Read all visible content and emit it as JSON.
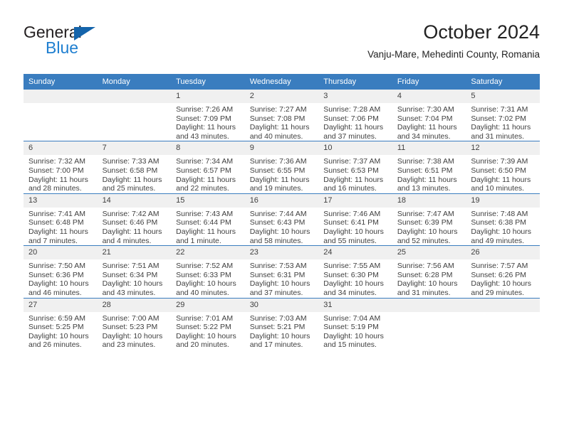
{
  "brand": {
    "name_top": "General",
    "name_bottom": "Blue",
    "triangle_color": "#1464ab",
    "top_color": "#231f20",
    "bottom_color": "#1f7fd0"
  },
  "header": {
    "title": "October 2024",
    "subtitle": "Vanju-Mare, Mehedinti County, Romania"
  },
  "theme": {
    "header_row_bg": "#3a7dbf",
    "header_row_text": "#ffffff",
    "daynum_bg": "#f0f0f0",
    "row_divider": "#3a7dbf",
    "body_text": "#3f3f3f"
  },
  "calendar": {
    "weekday_headers": [
      "Sunday",
      "Monday",
      "Tuesday",
      "Wednesday",
      "Thursday",
      "Friday",
      "Saturday"
    ],
    "labels": {
      "sunrise_prefix": "Sunrise:",
      "sunset_prefix": "Sunset:",
      "daylight_prefix": "Daylight:"
    },
    "weeks": [
      [
        {
          "day": "",
          "sunrise": "",
          "sunset": "",
          "daylight": "",
          "blank": true
        },
        {
          "day": "",
          "sunrise": "",
          "sunset": "",
          "daylight": "",
          "blank": true
        },
        {
          "day": "1",
          "sunrise": "Sunrise: 7:26 AM",
          "sunset": "Sunset: 7:09 PM",
          "daylight": "Daylight: 11 hours and 43 minutes."
        },
        {
          "day": "2",
          "sunrise": "Sunrise: 7:27 AM",
          "sunset": "Sunset: 7:08 PM",
          "daylight": "Daylight: 11 hours and 40 minutes."
        },
        {
          "day": "3",
          "sunrise": "Sunrise: 7:28 AM",
          "sunset": "Sunset: 7:06 PM",
          "daylight": "Daylight: 11 hours and 37 minutes."
        },
        {
          "day": "4",
          "sunrise": "Sunrise: 7:30 AM",
          "sunset": "Sunset: 7:04 PM",
          "daylight": "Daylight: 11 hours and 34 minutes."
        },
        {
          "day": "5",
          "sunrise": "Sunrise: 7:31 AM",
          "sunset": "Sunset: 7:02 PM",
          "daylight": "Daylight: 11 hours and 31 minutes."
        }
      ],
      [
        {
          "day": "6",
          "sunrise": "Sunrise: 7:32 AM",
          "sunset": "Sunset: 7:00 PM",
          "daylight": "Daylight: 11 hours and 28 minutes."
        },
        {
          "day": "7",
          "sunrise": "Sunrise: 7:33 AM",
          "sunset": "Sunset: 6:58 PM",
          "daylight": "Daylight: 11 hours and 25 minutes."
        },
        {
          "day": "8",
          "sunrise": "Sunrise: 7:34 AM",
          "sunset": "Sunset: 6:57 PM",
          "daylight": "Daylight: 11 hours and 22 minutes."
        },
        {
          "day": "9",
          "sunrise": "Sunrise: 7:36 AM",
          "sunset": "Sunset: 6:55 PM",
          "daylight": "Daylight: 11 hours and 19 minutes."
        },
        {
          "day": "10",
          "sunrise": "Sunrise: 7:37 AM",
          "sunset": "Sunset: 6:53 PM",
          "daylight": "Daylight: 11 hours and 16 minutes."
        },
        {
          "day": "11",
          "sunrise": "Sunrise: 7:38 AM",
          "sunset": "Sunset: 6:51 PM",
          "daylight": "Daylight: 11 hours and 13 minutes."
        },
        {
          "day": "12",
          "sunrise": "Sunrise: 7:39 AM",
          "sunset": "Sunset: 6:50 PM",
          "daylight": "Daylight: 11 hours and 10 minutes."
        }
      ],
      [
        {
          "day": "13",
          "sunrise": "Sunrise: 7:41 AM",
          "sunset": "Sunset: 6:48 PM",
          "daylight": "Daylight: 11 hours and 7 minutes."
        },
        {
          "day": "14",
          "sunrise": "Sunrise: 7:42 AM",
          "sunset": "Sunset: 6:46 PM",
          "daylight": "Daylight: 11 hours and 4 minutes."
        },
        {
          "day": "15",
          "sunrise": "Sunrise: 7:43 AM",
          "sunset": "Sunset: 6:44 PM",
          "daylight": "Daylight: 11 hours and 1 minute."
        },
        {
          "day": "16",
          "sunrise": "Sunrise: 7:44 AM",
          "sunset": "Sunset: 6:43 PM",
          "daylight": "Daylight: 10 hours and 58 minutes."
        },
        {
          "day": "17",
          "sunrise": "Sunrise: 7:46 AM",
          "sunset": "Sunset: 6:41 PM",
          "daylight": "Daylight: 10 hours and 55 minutes."
        },
        {
          "day": "18",
          "sunrise": "Sunrise: 7:47 AM",
          "sunset": "Sunset: 6:39 PM",
          "daylight": "Daylight: 10 hours and 52 minutes."
        },
        {
          "day": "19",
          "sunrise": "Sunrise: 7:48 AM",
          "sunset": "Sunset: 6:38 PM",
          "daylight": "Daylight: 10 hours and 49 minutes."
        }
      ],
      [
        {
          "day": "20",
          "sunrise": "Sunrise: 7:50 AM",
          "sunset": "Sunset: 6:36 PM",
          "daylight": "Daylight: 10 hours and 46 minutes."
        },
        {
          "day": "21",
          "sunrise": "Sunrise: 7:51 AM",
          "sunset": "Sunset: 6:34 PM",
          "daylight": "Daylight: 10 hours and 43 minutes."
        },
        {
          "day": "22",
          "sunrise": "Sunrise: 7:52 AM",
          "sunset": "Sunset: 6:33 PM",
          "daylight": "Daylight: 10 hours and 40 minutes."
        },
        {
          "day": "23",
          "sunrise": "Sunrise: 7:53 AM",
          "sunset": "Sunset: 6:31 PM",
          "daylight": "Daylight: 10 hours and 37 minutes."
        },
        {
          "day": "24",
          "sunrise": "Sunrise: 7:55 AM",
          "sunset": "Sunset: 6:30 PM",
          "daylight": "Daylight: 10 hours and 34 minutes."
        },
        {
          "day": "25",
          "sunrise": "Sunrise: 7:56 AM",
          "sunset": "Sunset: 6:28 PM",
          "daylight": "Daylight: 10 hours and 31 minutes."
        },
        {
          "day": "26",
          "sunrise": "Sunrise: 7:57 AM",
          "sunset": "Sunset: 6:26 PM",
          "daylight": "Daylight: 10 hours and 29 minutes."
        }
      ],
      [
        {
          "day": "27",
          "sunrise": "Sunrise: 6:59 AM",
          "sunset": "Sunset: 5:25 PM",
          "daylight": "Daylight: 10 hours and 26 minutes."
        },
        {
          "day": "28",
          "sunrise": "Sunrise: 7:00 AM",
          "sunset": "Sunset: 5:23 PM",
          "daylight": "Daylight: 10 hours and 23 minutes."
        },
        {
          "day": "29",
          "sunrise": "Sunrise: 7:01 AM",
          "sunset": "Sunset: 5:22 PM",
          "daylight": "Daylight: 10 hours and 20 minutes."
        },
        {
          "day": "30",
          "sunrise": "Sunrise: 7:03 AM",
          "sunset": "Sunset: 5:21 PM",
          "daylight": "Daylight: 10 hours and 17 minutes."
        },
        {
          "day": "31",
          "sunrise": "Sunrise: 7:04 AM",
          "sunset": "Sunset: 5:19 PM",
          "daylight": "Daylight: 10 hours and 15 minutes."
        },
        {
          "day": "",
          "sunrise": "",
          "sunset": "",
          "daylight": "",
          "blank": true
        },
        {
          "day": "",
          "sunrise": "",
          "sunset": "",
          "daylight": "",
          "blank": true
        }
      ]
    ]
  }
}
